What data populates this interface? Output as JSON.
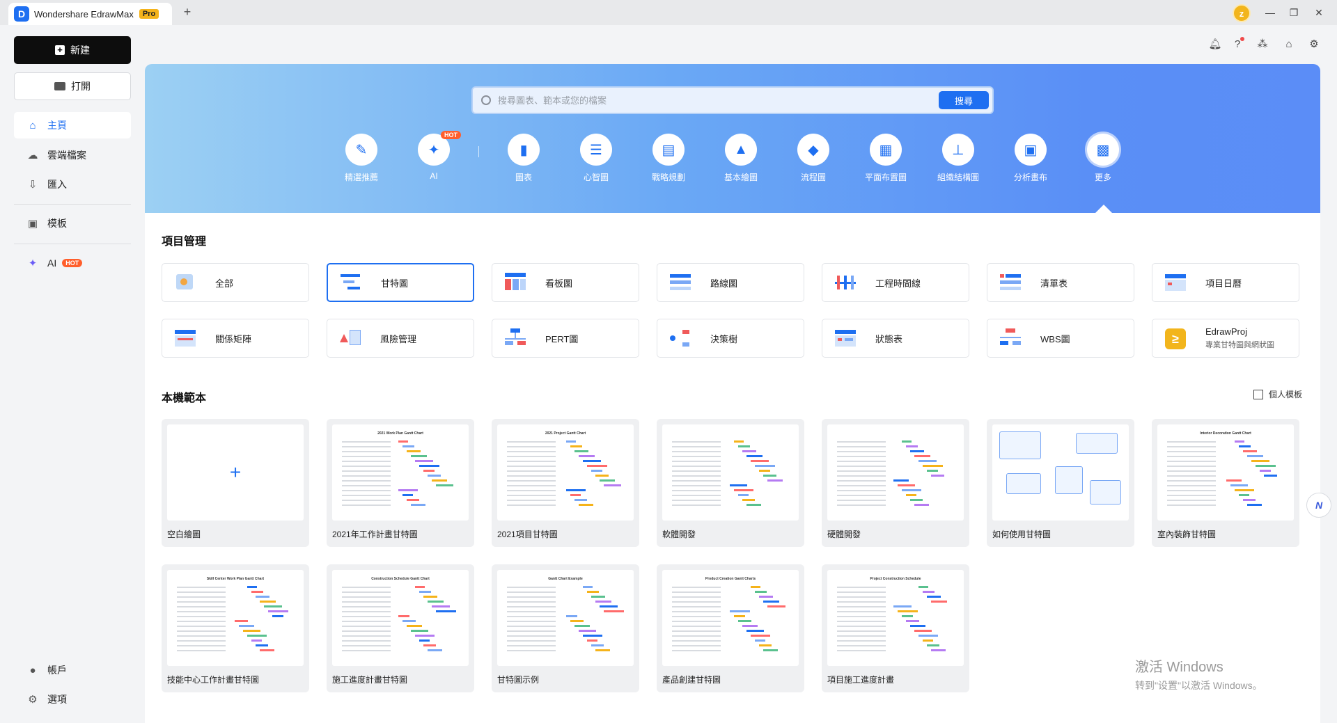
{
  "titlebar": {
    "app_name": "Wondershare EdrawMax",
    "badge": "Pro",
    "logo_letter": "D",
    "avatar_letter": "z"
  },
  "sidebar": {
    "new_label": "新建",
    "open_label": "打開",
    "items": [
      {
        "label": "主頁",
        "icon": "home-icon"
      },
      {
        "label": "雲端檔案",
        "icon": "cloud-icon"
      },
      {
        "label": "匯入",
        "icon": "import-icon"
      },
      {
        "label": "模板",
        "icon": "template-icon"
      },
      {
        "label": "AI",
        "icon": "sparkle-icon",
        "badge": "HOT"
      }
    ],
    "bottom": [
      {
        "label": "帳戶",
        "icon": "account-icon"
      },
      {
        "label": "選項",
        "icon": "gear-icon"
      }
    ]
  },
  "search": {
    "placeholder": "搜尋圖表、範本或您的檔案",
    "button": "搜尋"
  },
  "categories": [
    {
      "label": "精選推薦",
      "icon": "recommend-icon"
    },
    {
      "label": "AI",
      "icon": "ai-sparkle-icon",
      "badge": "HOT"
    },
    {
      "label": "圖表",
      "icon": "chart-icon"
    },
    {
      "label": "心智圖",
      "icon": "mindmap-icon"
    },
    {
      "label": "戰略規劃",
      "icon": "strategy-icon"
    },
    {
      "label": "基本繪圖",
      "icon": "basic-drawing-icon"
    },
    {
      "label": "流程圖",
      "icon": "flowchart-icon"
    },
    {
      "label": "平面布置圖",
      "icon": "floorplan-icon"
    },
    {
      "label": "組織結構圖",
      "icon": "orgchart-icon"
    },
    {
      "label": "分析畫布",
      "icon": "analysis-canvas-icon"
    },
    {
      "label": "更多",
      "icon": "more-grid-icon"
    }
  ],
  "project_mgmt": {
    "title": "項目管理",
    "items": [
      {
        "label": "全部"
      },
      {
        "label": "甘特圖"
      },
      {
        "label": "看板圖"
      },
      {
        "label": "路線圖"
      },
      {
        "label": "工程時間線"
      },
      {
        "label": "清單表"
      },
      {
        "label": "項目日曆"
      },
      {
        "label": "關係矩陣"
      },
      {
        "label": "風險管理"
      },
      {
        "label": "PERT圖"
      },
      {
        "label": "決策樹"
      },
      {
        "label": "狀態表"
      },
      {
        "label": "WBS圖"
      },
      {
        "label": "EdrawProj",
        "sub": "專業甘特圖與網狀圖"
      }
    ]
  },
  "local_templates": {
    "title": "本機範本",
    "my_templates": "個人模板",
    "items": [
      {
        "label": "空白繪圖"
      },
      {
        "label": "2021年工作計畫甘特圖",
        "thumb_title": "2021 Work Plan Gantt Chart"
      },
      {
        "label": "2021項目甘特圖",
        "thumb_title": "2021 Project Gantt Chart"
      },
      {
        "label": "軟體開發"
      },
      {
        "label": "硬體開發"
      },
      {
        "label": "如何使用甘特圖"
      },
      {
        "label": "室內裝飾甘特圖",
        "thumb_title": "Interior Decoration Gantt Chart"
      },
      {
        "label": "技能中心工作計畫甘特圖",
        "thumb_title": "Skill Center Work Plan Gantt Chart"
      },
      {
        "label": "施工進度計畫甘特圖",
        "thumb_title": "Construction Schedule Gantt Chart"
      },
      {
        "label": "甘特圖示例",
        "thumb_title": "Gantt Chart Example"
      },
      {
        "label": "產品創建甘特圖",
        "thumb_title": "Product Creation Gantt Charts"
      },
      {
        "label": "項目施工進度計畫",
        "thumb_title": "Project Construction Schedule"
      }
    ]
  },
  "watermark": {
    "line1": "激活 Windows",
    "line2": "转到\"设置\"以激活 Windows。"
  },
  "colors": {
    "accent": "#1e6ff1",
    "hot": "#ff5e2b",
    "pro": "#f5b31a"
  }
}
